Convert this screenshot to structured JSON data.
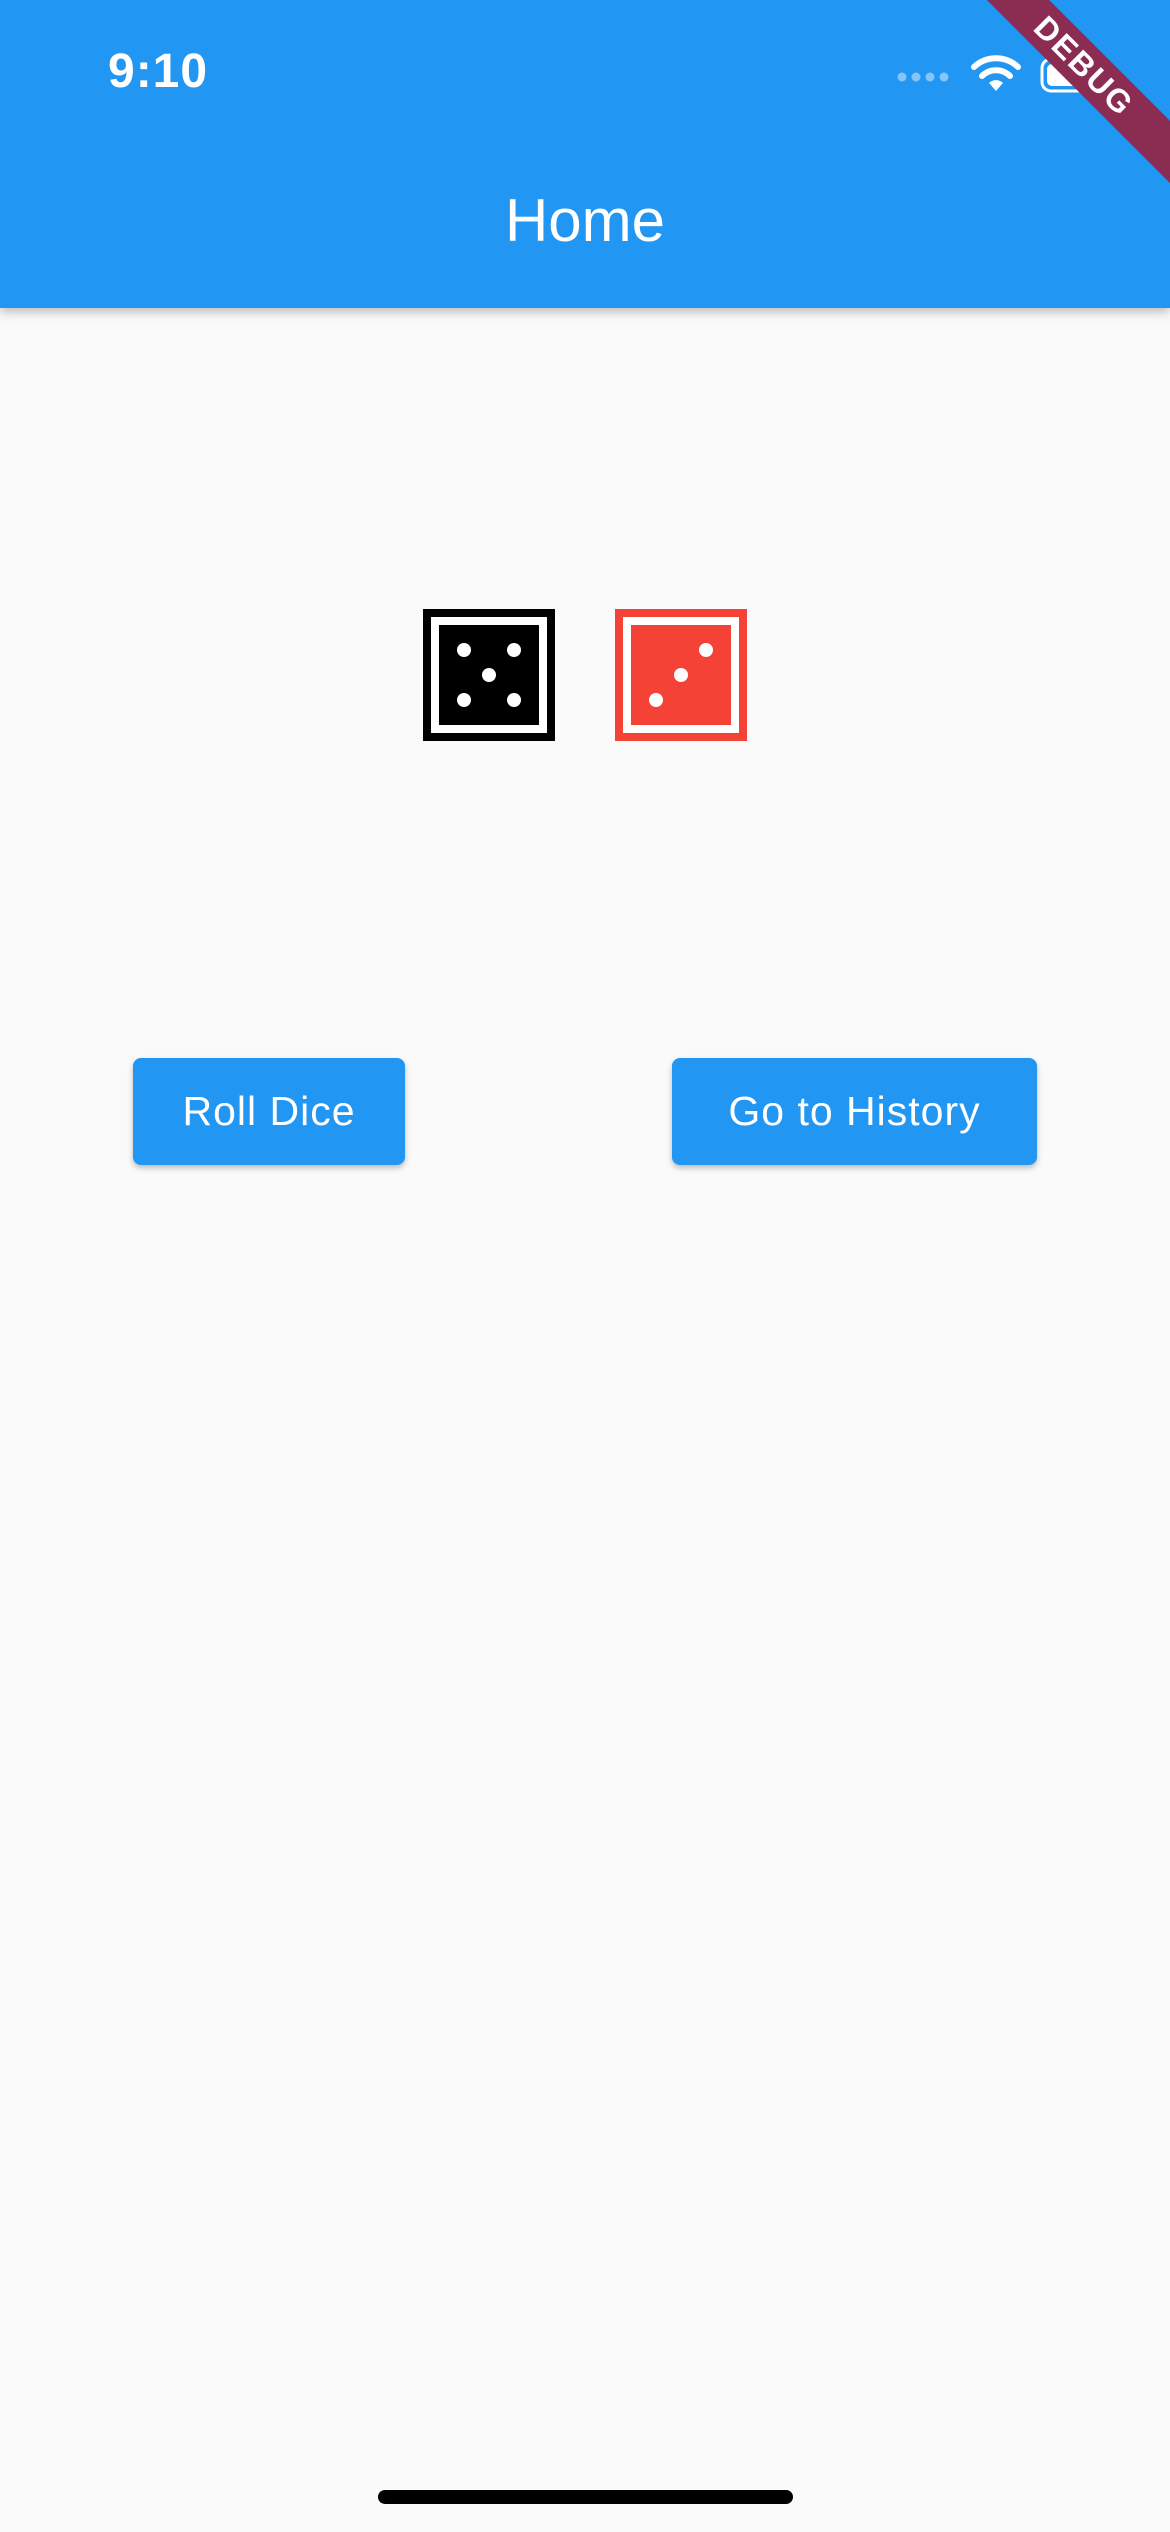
{
  "status_bar": {
    "time": "9:10",
    "icons": [
      "cellular-signal-icon",
      "wifi-icon",
      "battery-icon"
    ]
  },
  "debug_banner": "DEBUG",
  "appbar": {
    "title": "Home",
    "color": "#2196f3"
  },
  "dice": [
    {
      "name": "left-die",
      "face": 5,
      "color": "#000000"
    },
    {
      "name": "right-die",
      "face": 3,
      "color": "#f44336"
    }
  ],
  "buttons": {
    "roll_label": "Roll Dice",
    "history_label": "Go to History"
  },
  "colors": {
    "background": "#fafafa",
    "accent": "#2196f3",
    "debug": "#8b2d52"
  }
}
